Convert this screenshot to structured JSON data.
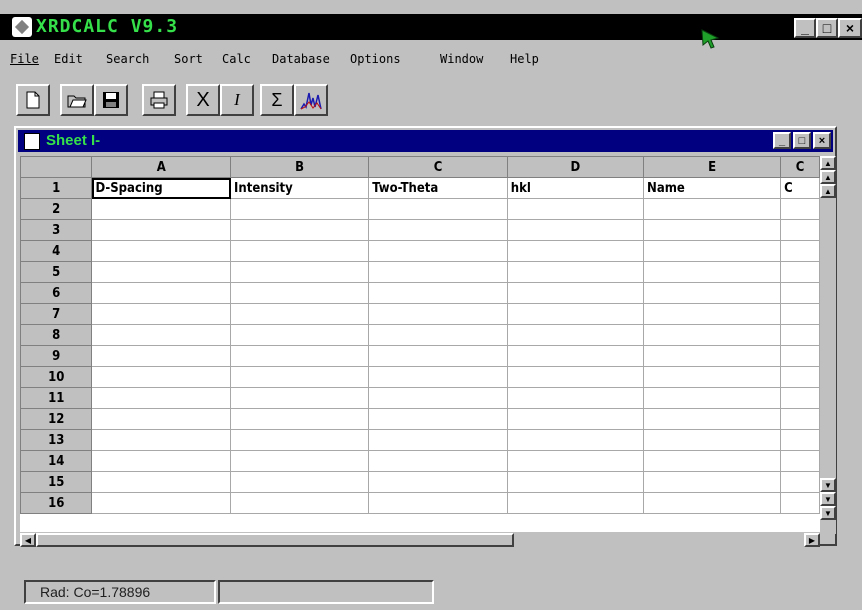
{
  "app": {
    "title": "XRDCALC V9.3"
  },
  "menu": [
    {
      "label": "File"
    },
    {
      "label": "Edit"
    },
    {
      "label": "Search"
    },
    {
      "label": "Sort"
    },
    {
      "label": "Calc"
    },
    {
      "label": "Database"
    },
    {
      "label": "Options"
    },
    {
      "label": "Window"
    },
    {
      "label": "Help"
    }
  ],
  "toolbar": {
    "icons": [
      "new-file-icon",
      "open-folder-icon",
      "save-disk-icon",
      "print-icon",
      "delete-x-icon",
      "italic-i-icon",
      "sum-sigma-icon",
      "chart-peaks-icon"
    ],
    "x_label": "X",
    "i_label": "I",
    "sigma_label": "Σ"
  },
  "sheet": {
    "title": "Sheet I-",
    "columns": [
      "A",
      "B",
      "C",
      "D",
      "E",
      "C"
    ],
    "rows": [
      "1",
      "2",
      "3",
      "4",
      "5",
      "6",
      "7",
      "8",
      "9",
      "10",
      "11",
      "12",
      "13",
      "14",
      "15",
      "16"
    ],
    "row1": [
      "D-Spacing",
      "Intensity",
      "Two-Theta",
      "hkl",
      "Name",
      "C"
    ]
  },
  "status": {
    "rad": "Rad: Co=1.78896",
    "second": ""
  },
  "colors": {
    "title_text": "#35e04a",
    "sheet_title_bg": "#000080",
    "face": "#c0c0c0"
  }
}
